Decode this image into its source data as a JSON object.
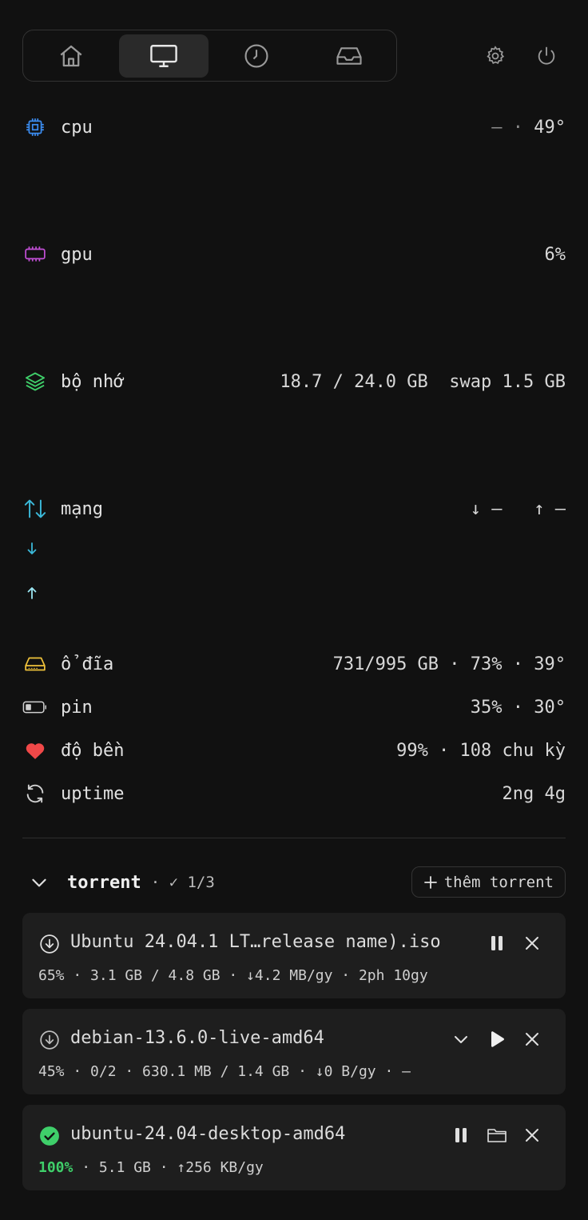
{
  "nav": {
    "tabs": [
      {
        "name": "home",
        "icon": "home-icon",
        "active": false
      },
      {
        "name": "monitor",
        "icon": "monitor-icon",
        "active": true
      },
      {
        "name": "history",
        "icon": "clock-icon",
        "active": false
      },
      {
        "name": "inbox",
        "icon": "inbox-icon",
        "active": false
      }
    ],
    "settings_icon": "gear-icon",
    "power_icon": "power-icon"
  },
  "metrics": {
    "cpu": {
      "label": "cpu",
      "value_left": "—",
      "sep": "·",
      "value": "49°",
      "color": "#3b8cf0"
    },
    "gpu": {
      "label": "gpu",
      "value": "6%",
      "color": "#c24fd6"
    },
    "memory": {
      "label": "bộ nhớ",
      "used": "18.7 / 24.0 GB",
      "swap": "swap 1.5 GB",
      "color": "#3fcf6a"
    },
    "network": {
      "label": "mạng",
      "down": "↓ —",
      "up": "↑ —",
      "color": "#3bb8d8"
    },
    "disk": {
      "label": "ổ đĩa",
      "value": "731/995 GB · 73% · 39°",
      "color": "#f0c23b"
    },
    "battery": {
      "label": "pin",
      "value": "35% · 30°",
      "color": "#d0d0d0"
    },
    "health": {
      "label": "độ bền",
      "value": "99% · 108 chu kỳ",
      "color": "#f04848"
    },
    "uptime": {
      "label": "uptime",
      "value": "2ng 4g",
      "color": "#d0d0d0"
    }
  },
  "torrent": {
    "title": "torrent",
    "count": "· ✓ 1/3",
    "add_label": "thêm torrent",
    "items": [
      {
        "name": "Ubuntu 24.04.1 LT…release name).iso",
        "meta": "65% · 3.1 GB / 4.8 GB · ↓4.2 MB/gy · 2ph 10gy",
        "status": "downloading"
      },
      {
        "name": "debian-13.6.0-live-amd64",
        "meta": "45% · 0/2 · 630.1 MB / 1.4 GB · ↓0 B/gy · —",
        "status": "paused"
      },
      {
        "name": "ubuntu-24.04-desktop-amd64",
        "meta_pct": "100%",
        "meta": " · 5.1 GB · ↑256 KB/gy",
        "status": "done"
      }
    ]
  }
}
